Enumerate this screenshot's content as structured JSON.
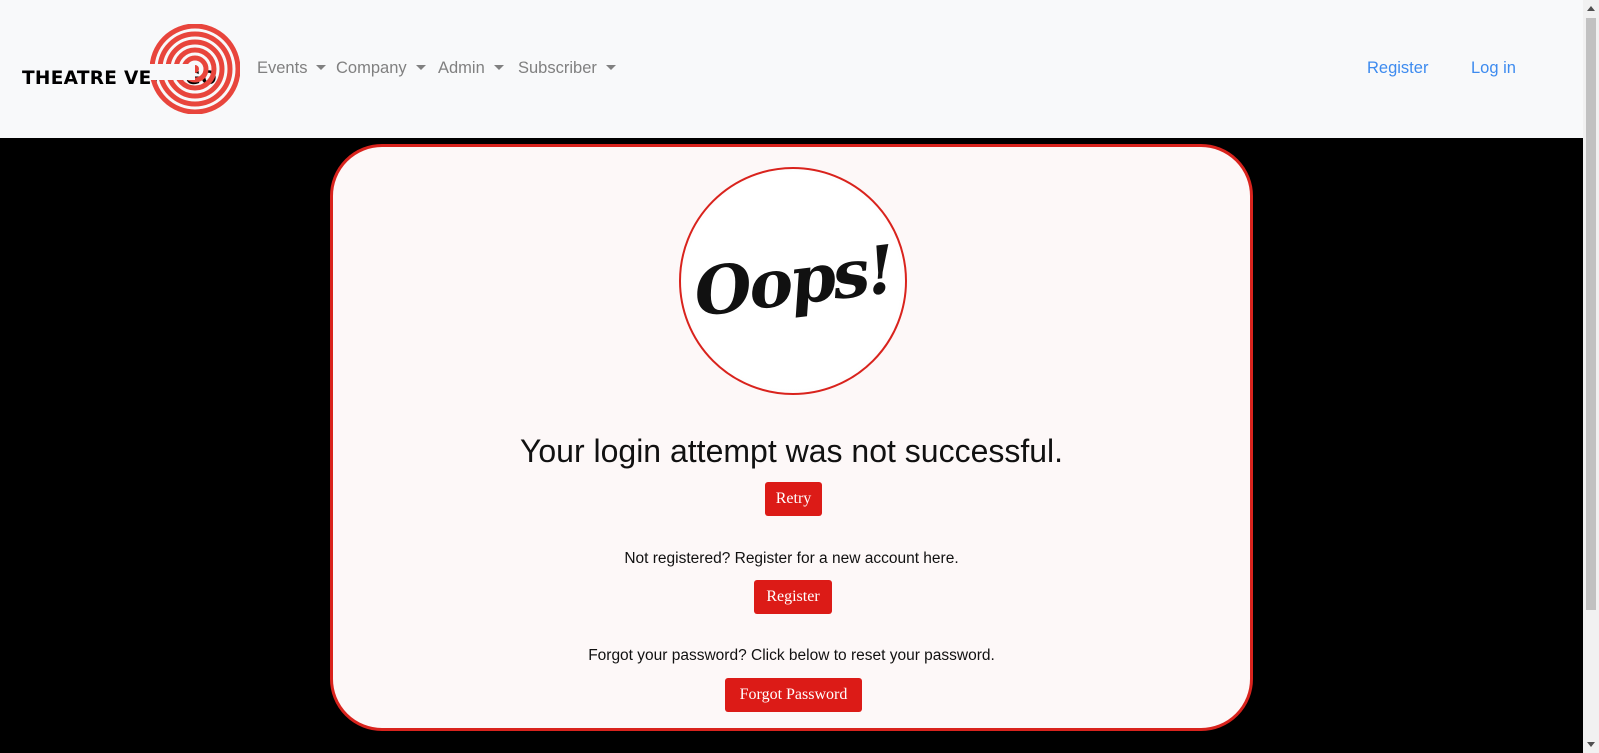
{
  "brand": {
    "name": "THEATRE VERTIGO",
    "logo_icon": "vertigo-spiral-logo",
    "accent": "#e8453c"
  },
  "nav": {
    "items": [
      {
        "label": "Events"
      },
      {
        "label": "Company"
      },
      {
        "label": "Admin"
      },
      {
        "label": "Subscriber"
      }
    ],
    "register_label": "Register",
    "login_label": "Log in"
  },
  "card": {
    "oops_text": "Oops!",
    "headline": "Your login attempt was not successful.",
    "retry_label": "Retry",
    "register_note": "Not registered? Register for a new account here.",
    "register_label": "Register",
    "forgot_note": "Forgot your password? Click below to reset your password.",
    "forgot_label": "Forgot Password"
  },
  "colors": {
    "primary": "#dc1b17",
    "link": "#3d8bef",
    "card_border": "#d9231d"
  }
}
